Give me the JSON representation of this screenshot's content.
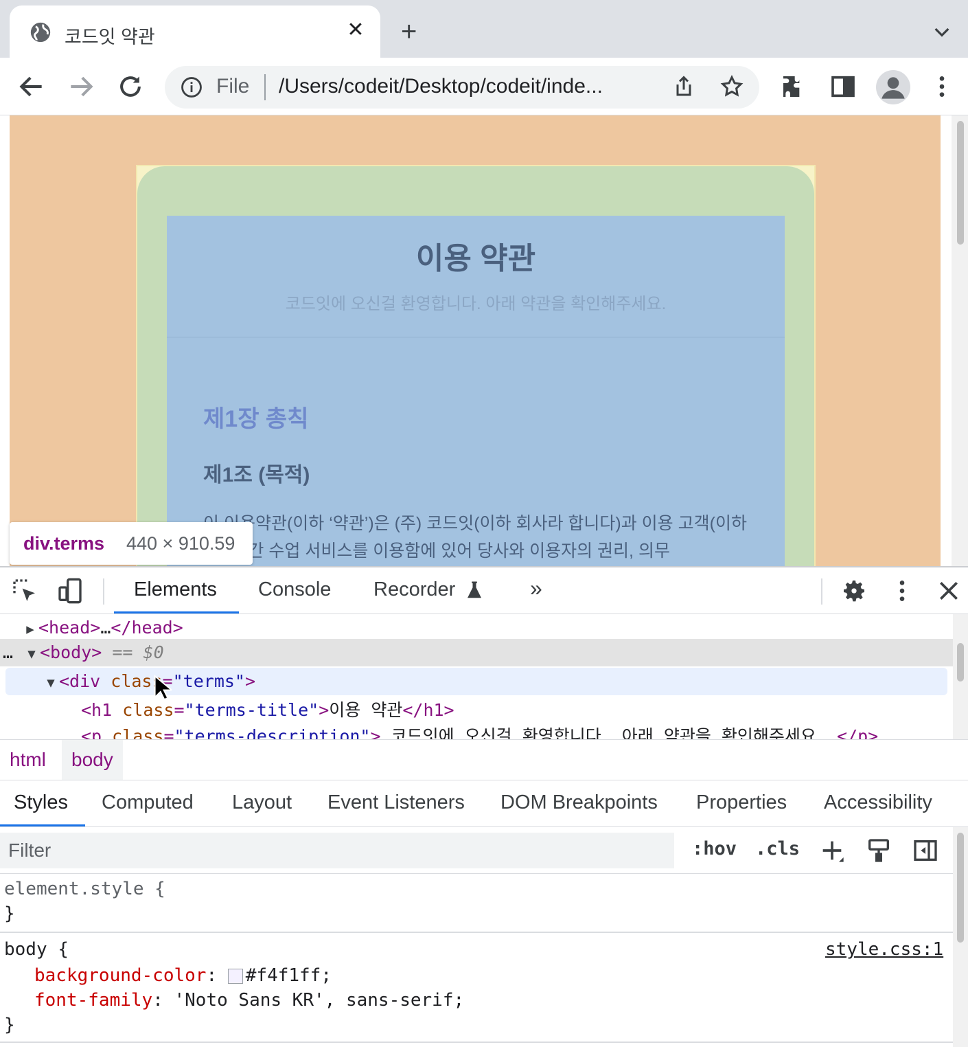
{
  "browser": {
    "tab": {
      "title": "코드잇 약관",
      "favicon": "globe-icon"
    },
    "address": {
      "scheme_label": "File",
      "url": "/Users/codeit/Desktop/codeit/inde..."
    }
  },
  "page": {
    "title": "이용 약관",
    "description": "코드잇에 오신걸 환영합니다. 아래 약관을 확인해주세요.",
    "chapter": "제1장 총칙",
    "article_title": "제1조 (목적)",
    "article_text": "이 이용약관(이하 ‘약관’)은 (주) 코드잇(이하 회사라 합니다)과 이용 고객(이하 ‘회원’)간 수업 서비스를 이용함에 있어 당사와 이용자의 권리, 의무"
  },
  "inspect_tooltip": {
    "element": "div.terms",
    "size": "440 × 910.59"
  },
  "devtools": {
    "tabs": [
      "Elements",
      "Console",
      "Recorder"
    ],
    "active_tab": "Elements",
    "dom": {
      "head_open": "<head>",
      "head_ellipsis": "…",
      "head_close": "</head>",
      "body_tag": "<body>",
      "body_ref": "== $0",
      "div_open": "<div",
      "div_attr": "class",
      "div_val": "\"terms\"",
      "h1_open": "<h1",
      "h1_attr": "class",
      "h1_val": "\"terms-title\"",
      "h1_text": "이용 약관",
      "h1_close": "</h1>",
      "p_open": "<p",
      "p_attr": "class",
      "p_val": "\"terms-description\"",
      "p_text": " 코드잇에 오신걸 환영합니다. 아래 약관을 확인해주세요. ",
      "p_close": "</p>"
    },
    "breadcrumbs": [
      "html",
      "body"
    ],
    "sidebar_tabs": [
      "Styles",
      "Computed",
      "Layout",
      "Event Listeners",
      "DOM Breakpoints",
      "Properties",
      "Accessibility"
    ],
    "filter_placeholder": "Filter",
    "hov_label": ":hov",
    "cls_label": ".cls",
    "styles": {
      "element_style": "element.style {",
      "close_brace": "}",
      "body_selector": "body {",
      "source": "style.css:1",
      "bg_prop": "background-color",
      "bg_value": "#f4f1ff;",
      "bg_swatch": "#f4f1ff",
      "font_prop": "font-family",
      "font_value": "'Noto Sans KR', sans-serif;"
    }
  }
}
